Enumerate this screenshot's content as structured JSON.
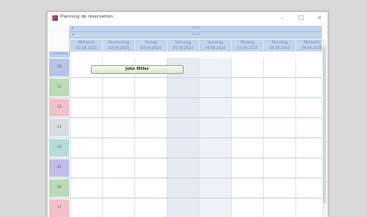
{
  "window": {
    "title": "Planning de réservation",
    "controls": {
      "minimize": "–",
      "maximize": "□",
      "close": "×"
    }
  },
  "calendar": {
    "year": "2025",
    "month": "Avril",
    "row_header": "Chambre",
    "days": [
      {
        "name": "Mittwoch",
        "date": "02.04.2025",
        "type": "weekday"
      },
      {
        "name": "Donnerstag",
        "date": "03.04.2025",
        "type": "weekday"
      },
      {
        "name": "Freitag",
        "date": "04.04.2025",
        "type": "weekday"
      },
      {
        "name": "Samstag",
        "date": "05.04.2025",
        "type": "sat"
      },
      {
        "name": "Sonntag",
        "date": "06.04.2025",
        "type": "sun"
      },
      {
        "name": "Montag",
        "date": "07.04.2025",
        "type": "weekday"
      },
      {
        "name": "Dienstag",
        "date": "08.04.2025",
        "type": "weekday"
      },
      {
        "name": "Mittwoch",
        "date": "09.04.2025",
        "type": "weekday"
      }
    ],
    "rooms": [
      {
        "label": "10",
        "color": "#b8c4e6"
      },
      {
        "label": "11",
        "color": "#b9dcb7"
      },
      {
        "label": "12",
        "color": "#f0c2c7"
      },
      {
        "label": "13",
        "color": "#d9dce1"
      },
      {
        "label": "14",
        "color": "#b5ddd6"
      },
      {
        "label": "15",
        "color": "#c3bde9"
      },
      {
        "label": "16",
        "color": "#b9dcb7"
      },
      {
        "label": "17",
        "color": "#f0c2c7"
      }
    ],
    "booking": {
      "guest": "John Miller"
    }
  }
}
